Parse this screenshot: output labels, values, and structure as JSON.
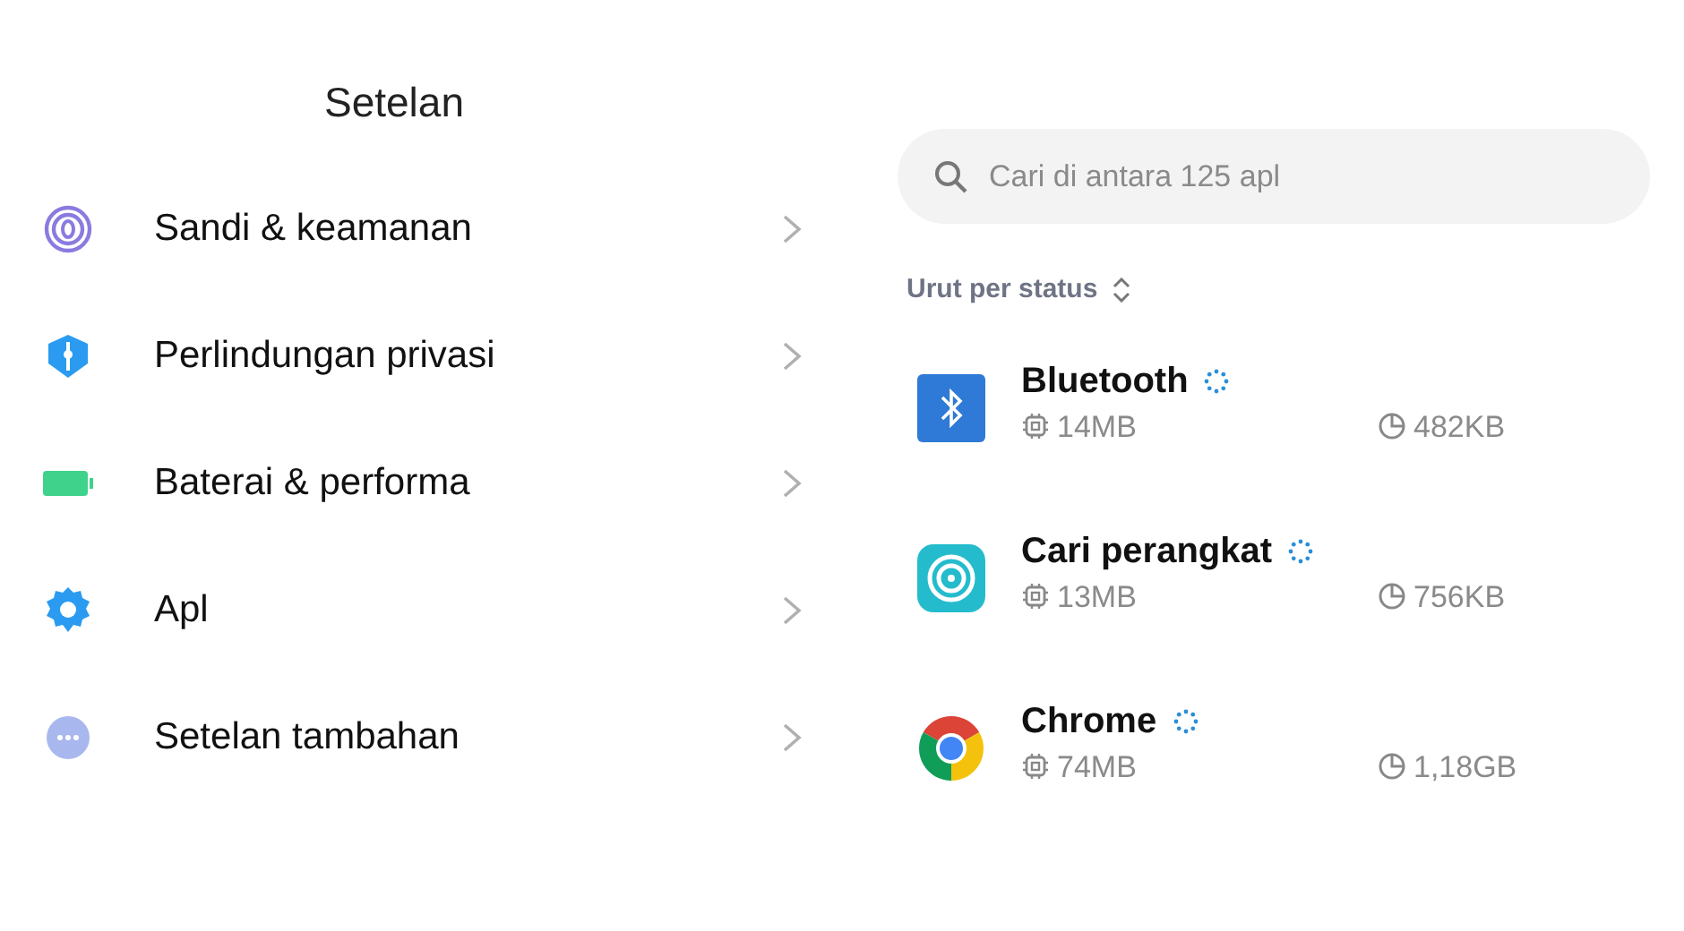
{
  "title": "Setelan",
  "settings": [
    {
      "kind": "fingerprint",
      "label": "Sandi & keamanan"
    },
    {
      "kind": "shield",
      "label": "Perlindungan privasi"
    },
    {
      "kind": "battery",
      "label": "Baterai & performa"
    },
    {
      "kind": "gear",
      "label": "Apl"
    },
    {
      "kind": "more",
      "label": "Setelan tambahan"
    }
  ],
  "search": {
    "placeholder": "Cari di antara 125 apl"
  },
  "sort": {
    "label": "Urut per status"
  },
  "apps": [
    {
      "kind": "bluetooth",
      "name": "Bluetooth",
      "memory": "14MB",
      "storage": "482KB"
    },
    {
      "kind": "finder",
      "name": "Cari perangkat",
      "memory": "13MB",
      "storage": "756KB"
    },
    {
      "kind": "browser",
      "name": "Chrome",
      "memory": "74MB",
      "storage": "1,18GB"
    }
  ]
}
